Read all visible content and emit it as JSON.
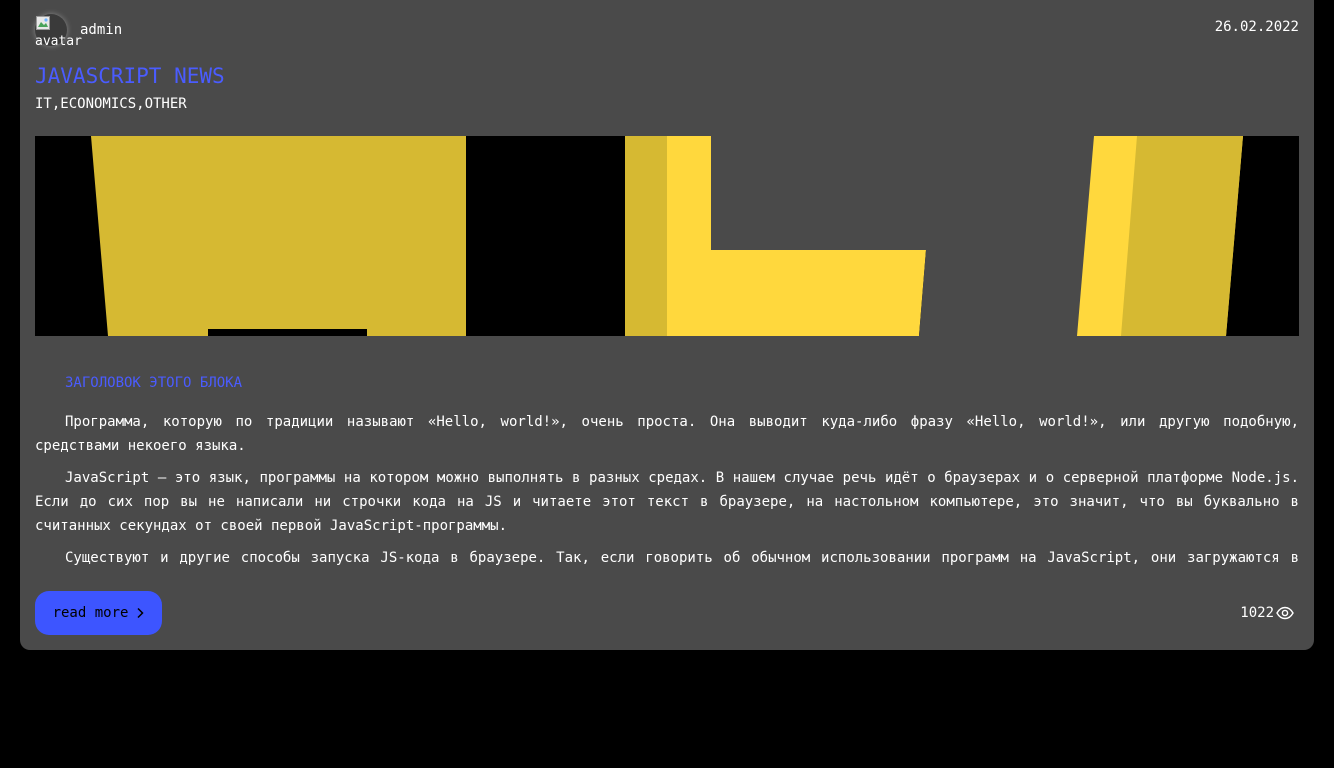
{
  "post": {
    "author": {
      "name": "admin",
      "avatar_alt": "avatar"
    },
    "date": "26.02.2022",
    "title": "JAVASCRIPT NEWS",
    "categories": "IT,ECONOMICS,OTHER",
    "hero_image": {
      "description": "yellow JS logo close-up",
      "colors": {
        "background": "#000000",
        "yellow": "#ffd83d",
        "yellow_shadow": "#d6b932",
        "gray": "#4a4a4a"
      }
    },
    "subheading": "ЗАГОЛОВОК ЭТОГО БЛОКА",
    "paragraphs": [
      "Программа, которую по традиции называют «Hello, world!», очень проста. Она выводит куда-либо фразу «Hello, world!», или другую подобную, средствами некоего языка.",
      "JavaScript — это язык, программы на котором можно выполнять в разных средах. В нашем случае речь идёт о браузерах и о серверной платформе Node.js. Если до сих пор вы не написали ни строчки кода на JS и читаете этот текст в браузере, на настольном компьютере, это значит, что вы буквально в считанных секундах от своей первой JavaScript-программы.",
      "Существуют и другие способы запуска JS-кода в браузере. Так, если говорить об обычном использовании программ на JavaScript, они загружаются в браузер для обеспечения работы веб-страниц."
    ],
    "read_more_label": "read more",
    "views": "1022"
  },
  "colors": {
    "page_background": "#000000",
    "card_background": "#4a4a4a",
    "accent": "#4a5cff",
    "button": "#3d55ff"
  },
  "icons": {
    "read_more": "chevron-right-icon",
    "views": "eye-icon",
    "avatar": "broken-image-icon"
  }
}
